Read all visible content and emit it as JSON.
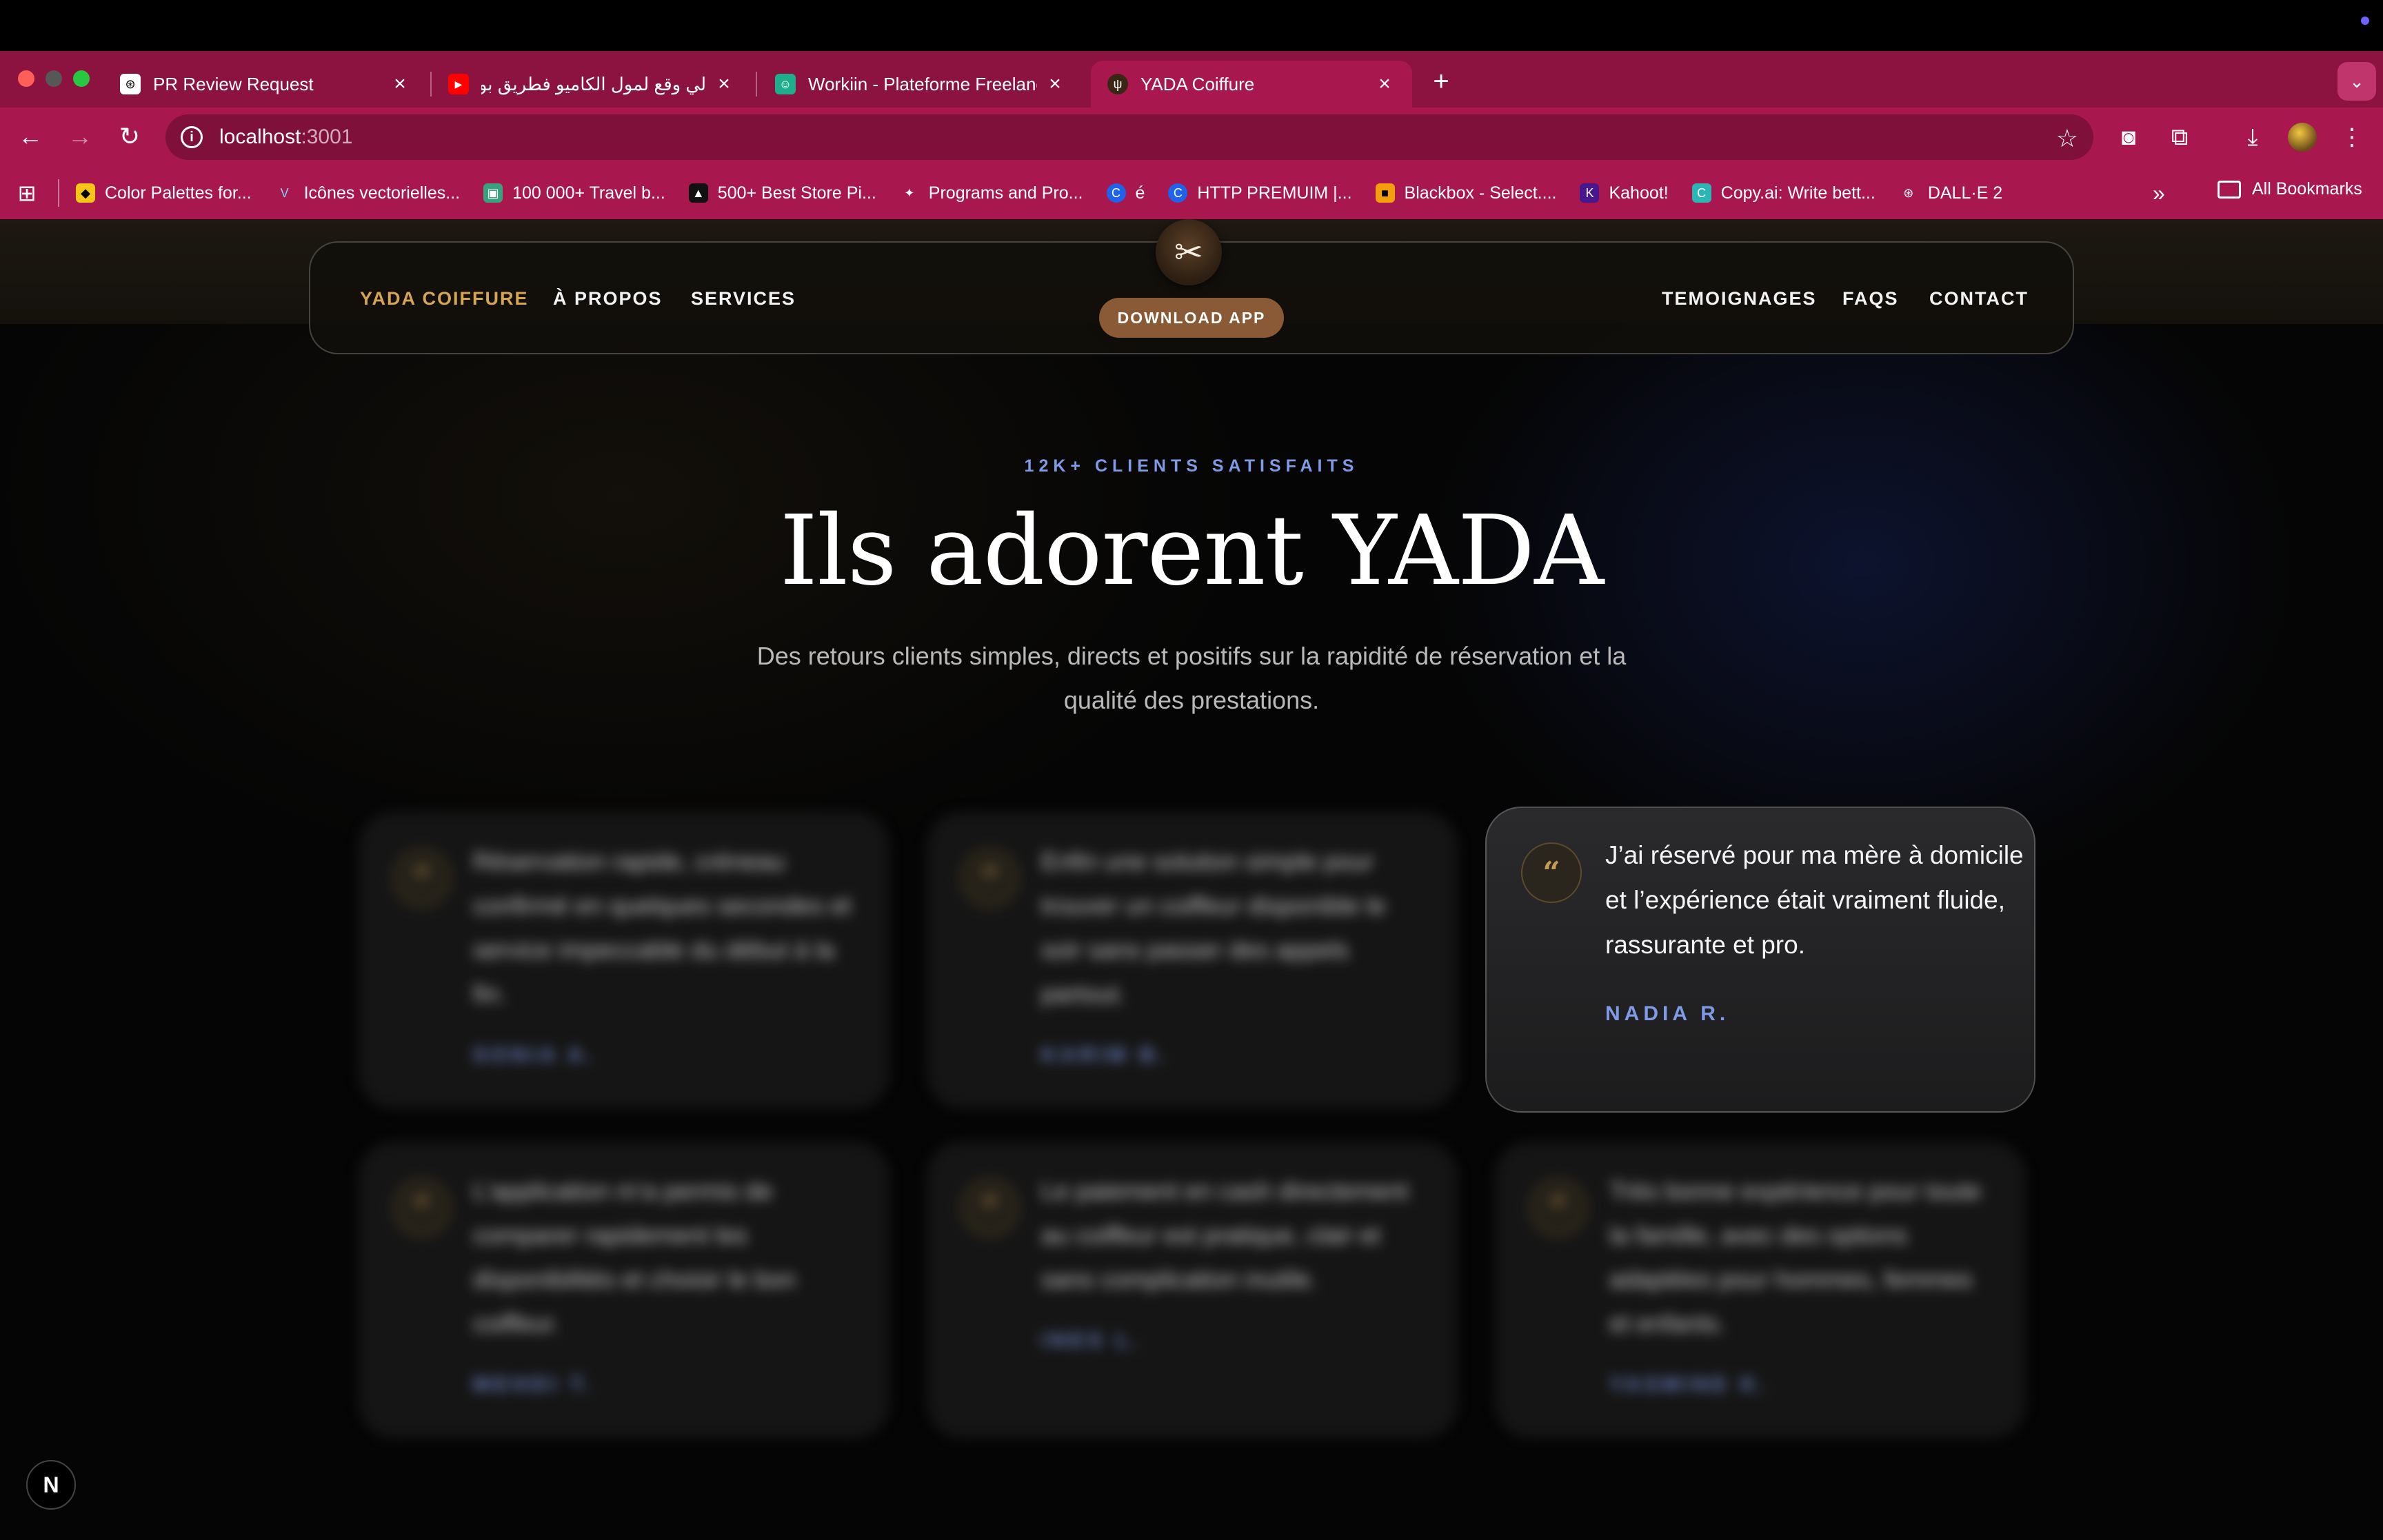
{
  "browser": {
    "tabs": [
      {
        "title": "PR Review Request",
        "favicon": "openai-icon"
      },
      {
        "title": "لي وقع لمول الكاميو فطريق بولمان",
        "favicon": "youtube-icon"
      },
      {
        "title": "Workiin - Plateforme Freelanc",
        "favicon": "workiin-icon"
      },
      {
        "title": "YADA Coiffure",
        "favicon": "yada-icon"
      }
    ],
    "address": {
      "host": "localhost",
      "port": ":3001"
    },
    "bookmarks": [
      {
        "label": "Color Palettes for...",
        "icon": "shield-icon"
      },
      {
        "label": "Icônes vectorielles...",
        "icon": "v-icon"
      },
      {
        "label": "100 000+ Travel b...",
        "icon": "image-icon"
      },
      {
        "label": "500+ Best Store Pi...",
        "icon": "store-icon"
      },
      {
        "label": "Programs and Pro...",
        "icon": "star-icon"
      },
      {
        "label": "é",
        "icon": "c-icon"
      },
      {
        "label": "HTTP PREMUIM |...",
        "icon": "c-icon"
      },
      {
        "label": "Blackbox - Select....",
        "icon": "box-icon"
      },
      {
        "label": "Kahoot!",
        "icon": "k-icon"
      },
      {
        "label": "Copy.ai: Write bett...",
        "icon": "c-icon"
      },
      {
        "label": "DALL·E 2",
        "icon": "openai-icon"
      }
    ],
    "all_bookmarks": "All Bookmarks"
  },
  "nav": {
    "brand": "YADA COIFFURE",
    "about": "À PROPOS",
    "services": "SERVICES",
    "testimonials": "TEMOIGNAGES",
    "faqs": "FAQS",
    "contact": "CONTACT",
    "download": "DOWNLOAD APP"
  },
  "hero": {
    "eyebrow": "12K+ CLIENTS SATISFAITS",
    "title": "Ils adorent YADA",
    "subtitle": "Des retours clients simples, directs et positifs sur la rapidité de réservation et la qualité des prestations."
  },
  "testimonials": [
    {
      "quote": "Réservation rapide, créneau confirmé en quelques secondes et service impeccable du début à la fin.",
      "author": "SONIA A."
    },
    {
      "quote": "Enfin une solution simple pour trouver un coiffeur disponible le soir sans passer des appels partout.",
      "author": "KARIM B."
    },
    {
      "quote": "J’ai réservé pour ma mère à domicile et l’expérience était vraiment fluide, rassurante et pro.",
      "author": "NADIA R."
    },
    {
      "quote": "L’application m’a permis de comparer rapidement les disponibilités et choisir le bon coiffeur.",
      "author": "MEHDI T."
    },
    {
      "quote": "Le paiement en cash directement au coiffeur est pratique, clair et sans complication inutile.",
      "author": "INES L."
    },
    {
      "quote": "Très bonne expérience pour toute la famille, avec des options adaptées pour hommes, femmes et enfants.",
      "author": "YASMINE K."
    }
  ],
  "quote_glyph": "“",
  "next_badge": "N"
}
